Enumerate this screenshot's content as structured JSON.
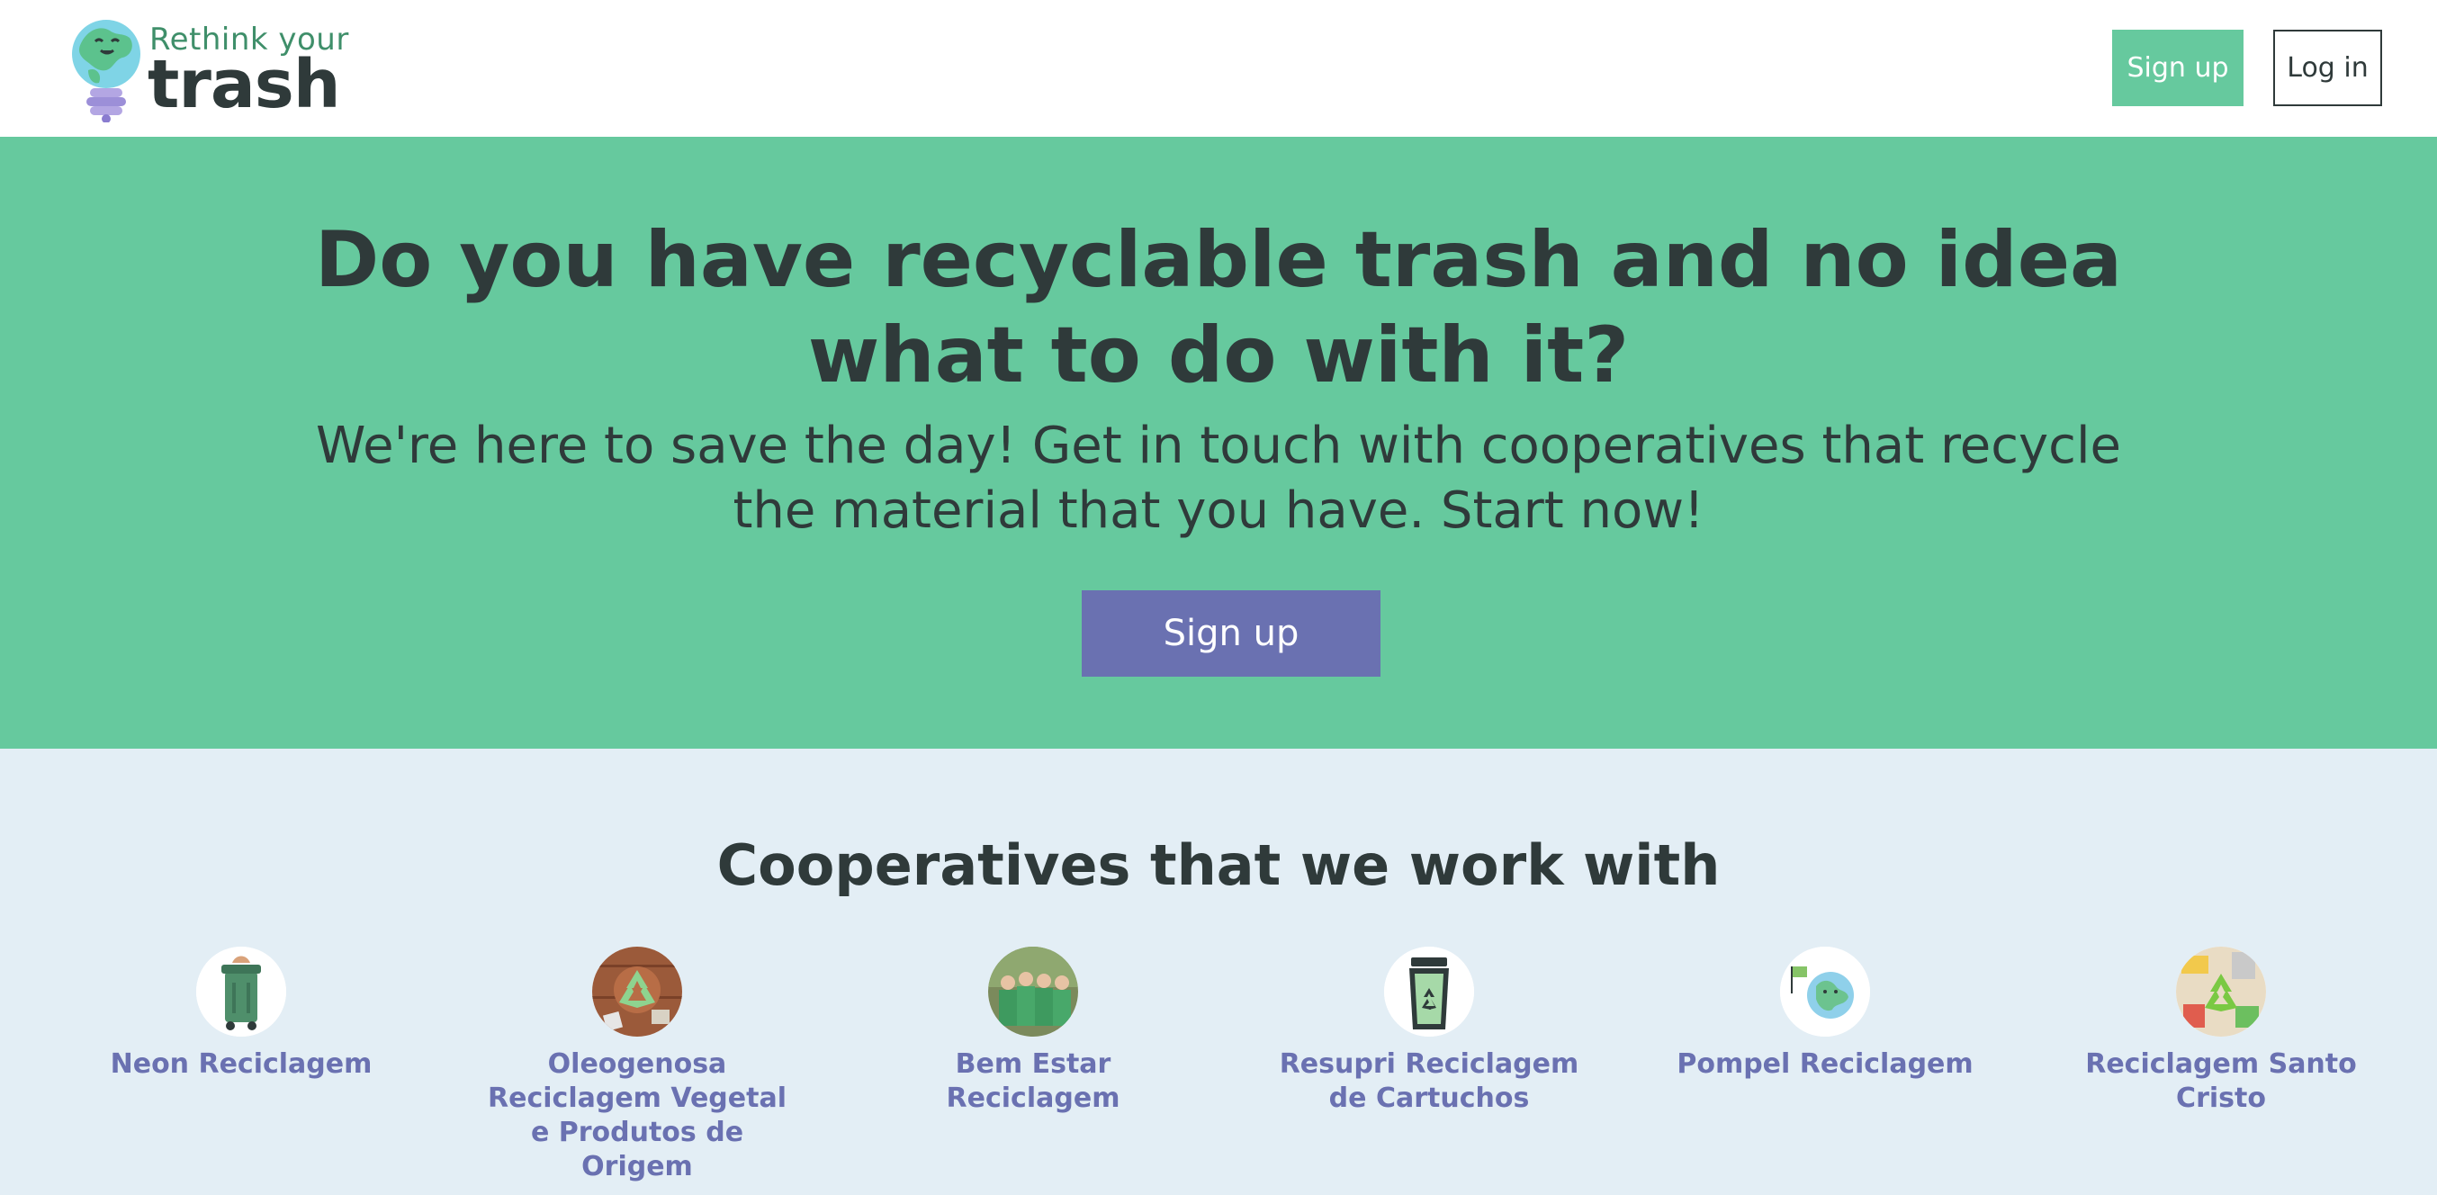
{
  "header": {
    "logo": {
      "line1": "Rethink your",
      "line2": "trash"
    },
    "signup_label": "Sign up",
    "login_label": "Log in"
  },
  "hero": {
    "title": "Do you have recyclable trash and no idea what to do with it?",
    "subtitle": "We're here to save the day! Get in touch with cooperatives that recycle the material that you have. Start now!",
    "signup_label": "Sign up"
  },
  "cooperatives": {
    "title": "Cooperatives that we work with",
    "items": [
      {
        "name": "Neon Reciclagem",
        "icon": "green-trash-bin-image"
      },
      {
        "name": "Oleogenosa Reciclagem Vegetal e Produtos de Origem",
        "icon": "recycle-symbol-wood-image"
      },
      {
        "name": "Bem Estar Reciclagem",
        "icon": "group-photo-image"
      },
      {
        "name": "Resupri Reciclagem de Cartuchos",
        "icon": "recycle-bin-image"
      },
      {
        "name": "Pompel Reciclagem",
        "icon": "earth-character-image"
      },
      {
        "name": "Reciclagem Santo Cristo",
        "icon": "recycled-items-image"
      }
    ]
  },
  "colors": {
    "brand_green": "#66c99e",
    "brand_purple": "#6a71b1",
    "dark_text": "#2f3a3a",
    "section_bg": "#e3eef5"
  }
}
